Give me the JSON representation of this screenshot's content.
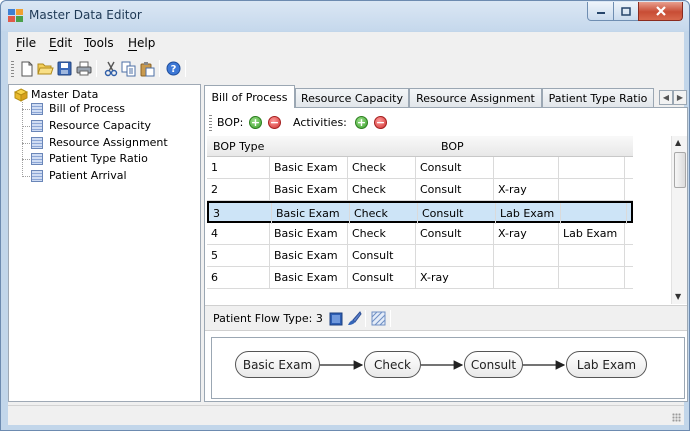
{
  "window": {
    "title": "Master Data Editor"
  },
  "menu": [
    {
      "label": "File",
      "accel": "F",
      "rest": "ile"
    },
    {
      "label": "Edit",
      "accel": "E",
      "rest": "dit"
    },
    {
      "label": "Tools",
      "accel": "T",
      "rest": "ools"
    },
    {
      "label": "Help",
      "accel": "H",
      "rest": "elp"
    }
  ],
  "toolbar_icons": [
    "new-icon",
    "open-icon",
    "save-icon",
    "print-icon",
    "cut-icon",
    "copy-icon",
    "paste-icon",
    "help-icon"
  ],
  "tree": {
    "root": "Master Data",
    "children": [
      "Bill of Process",
      "Resource Capacity",
      "Resource Assignment",
      "Patient Type Ratio",
      "Patient Arrival"
    ]
  },
  "tabs": [
    "Bill of Process",
    "Resource Capacity",
    "Resource Assignment",
    "Patient Type Ratio"
  ],
  "active_tab": "Bill of Process",
  "inner_toolbar": {
    "bop_label": "BOP:",
    "activities_label": "Activities:"
  },
  "grid": {
    "headers": {
      "bop_type": "BOP Type",
      "bop": "BOP"
    },
    "rows": [
      [
        "1",
        "Basic Exam",
        "Check",
        "Consult",
        "",
        ""
      ],
      [
        "2",
        "Basic Exam",
        "Check",
        "Consult",
        "X-ray",
        ""
      ],
      [
        "3",
        "Basic Exam",
        "Check",
        "Consult",
        "Lab Exam",
        ""
      ],
      [
        "4",
        "Basic Exam",
        "Check",
        "Consult",
        "X-ray",
        "Lab Exam"
      ],
      [
        "5",
        "Basic Exam",
        "Consult",
        "",
        "",
        ""
      ],
      [
        "6",
        "Basic Exam",
        "Consult",
        "X-ray",
        "",
        ""
      ]
    ],
    "selected_row": 2
  },
  "flow": {
    "label": "Patient Flow Type: 3",
    "nodes": [
      "Basic Exam",
      "Check",
      "Consult",
      "Lab Exam"
    ]
  },
  "colors": {
    "selection": "#cde4f7",
    "titlebar": "#c5d8ec",
    "close": "#c84d35"
  }
}
